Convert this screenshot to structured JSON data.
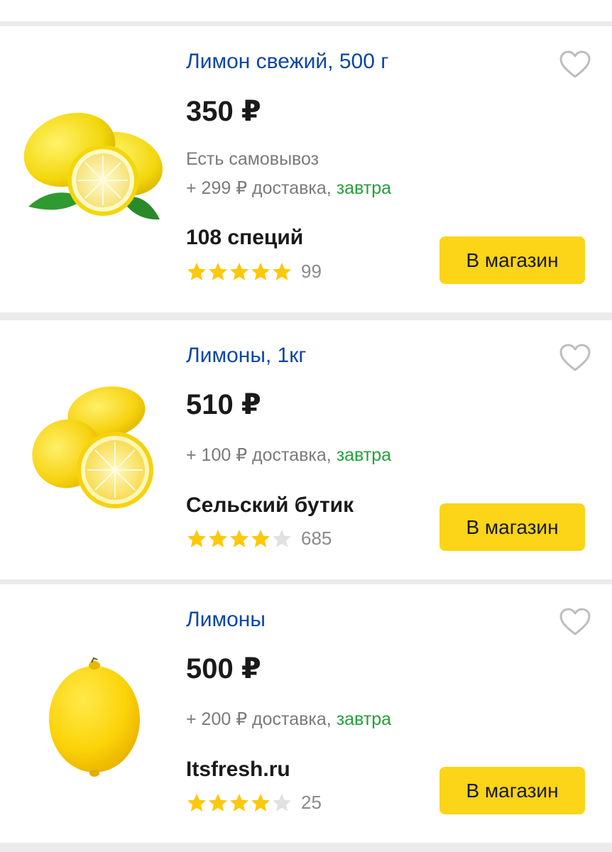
{
  "colors": {
    "title": "#0b46a8",
    "delivery_date": "#21a038",
    "button": "#fcd418",
    "star_on": "#fcc80a",
    "star_off": "#e1e1e1",
    "muted_text": "#7a7a7a"
  },
  "offers": [
    {
      "title": "Лимон свежий, 500 г",
      "price": "350 ₽",
      "pickup": "Есть самовывоз",
      "delivery_cost": "+ 299 ₽ доставка, ",
      "delivery_when": "завтра",
      "shop": "108 специй",
      "rating_stars": 5,
      "reviews": "99",
      "button_label": "В магазин",
      "favorite_icon": "heart-outline-icon",
      "image_icon": "lemons-with-leaves"
    },
    {
      "title": "Лимоны, 1кг",
      "price": "510 ₽",
      "delivery_cost": "+ 100 ₽ доставка, ",
      "delivery_when": "завтра",
      "shop": "Сельский бутик",
      "rating_stars": 4,
      "reviews": "685",
      "button_label": "В магазин",
      "favorite_icon": "heart-outline-icon",
      "image_icon": "lemons-halved"
    },
    {
      "title": "Лимоны",
      "price": "500 ₽",
      "delivery_cost": "+ 200 ₽ доставка, ",
      "delivery_when": "завтра",
      "shop": "Itsfresh.ru",
      "rating_stars": 4,
      "reviews": "25",
      "button_label": "В магазин",
      "favorite_icon": "heart-outline-icon",
      "image_icon": "single-lemon"
    }
  ]
}
